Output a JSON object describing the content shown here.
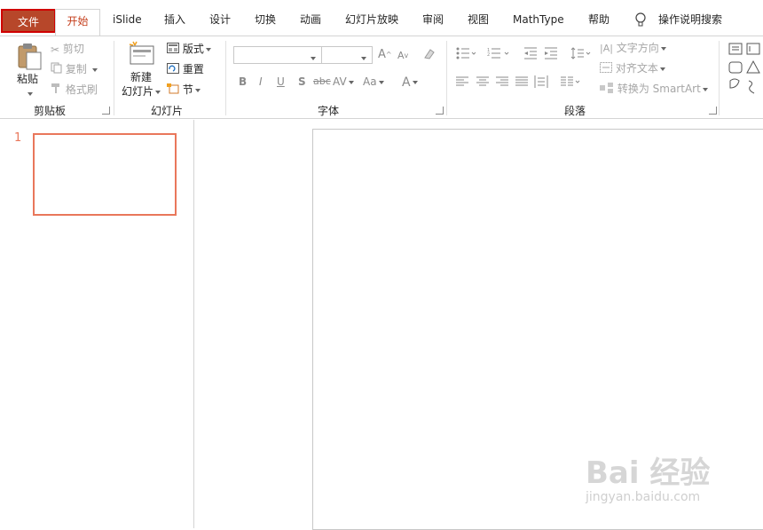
{
  "tabs": [
    {
      "label": "文件"
    },
    {
      "label": "开始"
    },
    {
      "label": "iSlide"
    },
    {
      "label": "插入"
    },
    {
      "label": "设计"
    },
    {
      "label": "切换"
    },
    {
      "label": "动画"
    },
    {
      "label": "幻灯片放映"
    },
    {
      "label": "审阅"
    },
    {
      "label": "视图"
    },
    {
      "label": "MathType"
    },
    {
      "label": "帮助"
    },
    {
      "label": "操作说明搜索"
    }
  ],
  "clipboard": {
    "paste": "粘贴",
    "cut": "剪切",
    "copy": "复制",
    "format_painter": "格式刷",
    "group": "剪贴板"
  },
  "slides": {
    "new_line1": "新建",
    "new_line2": "幻灯片",
    "layout": "版式",
    "reset": "重置",
    "section": "节",
    "group": "幻灯片"
  },
  "font": {
    "group": "字体",
    "bold": "B",
    "italic": "I",
    "underline": "U",
    "shadow": "S",
    "strike": "abc",
    "spacing": "AV",
    "case": "Aa",
    "color": "A",
    "grow": "A",
    "shrink": "A"
  },
  "paragraph": {
    "group": "段落",
    "text_direction": "文字方向",
    "align_text": "对齐文本",
    "smartart": "转换为 SmartArt"
  },
  "thumbnails": [
    {
      "number": "1"
    }
  ],
  "watermark": {
    "brand": "Bai 经验",
    "url": "jingyan.baidu.com"
  },
  "colors": {
    "accent": "#c43e1c",
    "file_tab": "#b7472a",
    "thumb_border": "#e9775b"
  }
}
